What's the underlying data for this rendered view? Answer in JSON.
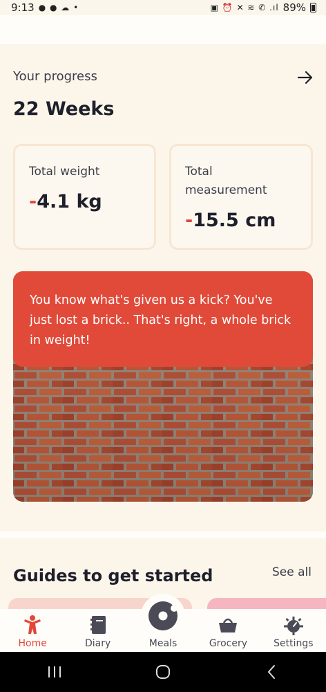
{
  "status_bar": {
    "time": "9:13",
    "battery": "89%"
  },
  "progress": {
    "label": "Your progress",
    "weeks": "22 Weeks",
    "cards": [
      {
        "label": "Total weight",
        "sign": "-",
        "value": "4.1 kg"
      },
      {
        "label": "Total measurement",
        "sign": "-",
        "value": "15.5 cm"
      }
    ]
  },
  "brick_card": {
    "message": "You know what's given us a kick? You've just lost a brick.. That's right, a whole brick in weight!"
  },
  "guides": {
    "title": "Guides to get started",
    "see_all": "See all"
  },
  "bottom_nav": {
    "items": [
      {
        "label": "Home",
        "icon": "person-icon",
        "active": true
      },
      {
        "label": "Diary",
        "icon": "diary-icon",
        "active": false
      },
      {
        "label": "Meals",
        "icon": "donut-icon",
        "active": false
      },
      {
        "label": "Grocery",
        "icon": "basket-icon",
        "active": false
      },
      {
        "label": "Settings",
        "icon": "gear-icon",
        "active": false
      }
    ]
  },
  "colors": {
    "accent": "#e2473a",
    "background": "#fcf6ea",
    "text": "#1e1f2b"
  }
}
